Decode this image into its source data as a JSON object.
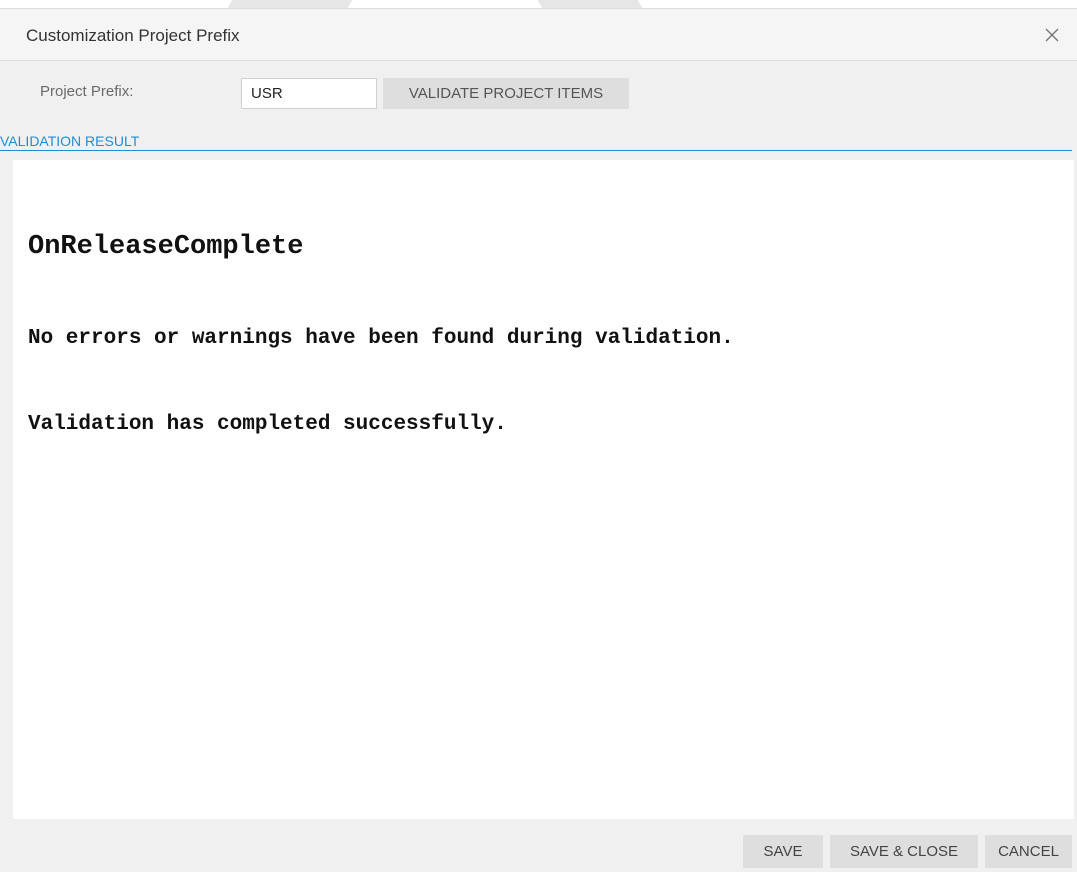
{
  "dialog": {
    "title": "Customization Project Prefix"
  },
  "form": {
    "prefix_label": "Project Prefix:",
    "prefix_value": "USR",
    "validate_label": "VALIDATE PROJECT ITEMS"
  },
  "validation": {
    "section_label": "VALIDATION RESULT",
    "heading": "OnReleaseComplete",
    "lines": [
      "No errors or warnings have been found during validation.",
      "Validation has completed successfully."
    ]
  },
  "footer": {
    "save_label": "SAVE",
    "save_close_label": "SAVE & CLOSE",
    "cancel_label": "CANCEL"
  },
  "colors": {
    "accent": "#1f8dd6",
    "button_bg": "#dedede",
    "dialog_bg": "#f0f0f0"
  },
  "icons": {
    "close": "close-icon"
  }
}
